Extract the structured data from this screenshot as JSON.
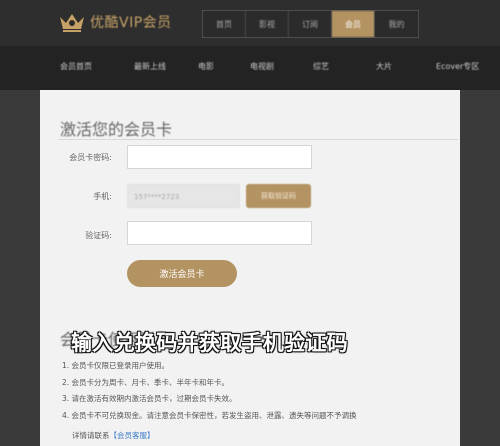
{
  "header": {
    "logo_text": "优酷VIP会员",
    "tabs": [
      {
        "label": "首页"
      },
      {
        "label": "影视"
      },
      {
        "label": "订阅"
      },
      {
        "label": "会员"
      },
      {
        "label": "我的"
      }
    ],
    "active_tab": 3
  },
  "nav": {
    "items": [
      {
        "label": "会员首页"
      },
      {
        "label": "最新上线"
      },
      {
        "label": "电影"
      },
      {
        "label": "电视剧"
      },
      {
        "label": "综艺"
      },
      {
        "label": "大片"
      },
      {
        "label": "Ecover专区"
      }
    ]
  },
  "form": {
    "title": "激活您的会员卡",
    "card_label": "会员卡密码:",
    "card_value": "",
    "phone_label": "手机:",
    "phone_value": "157****2723",
    "sms_button": "获取验证码",
    "code_label": "验证码:",
    "code_value": "",
    "submit_button": "激活会员卡"
  },
  "notice": {
    "title": "会员卡使用说明",
    "rules": [
      "1. 会员卡仅限已登录用户使用。",
      "2. 会员卡分为周卡、月卡、季卡、半年卡和年卡。",
      "3. 请在激活有效期内激活会员卡，过期会员卡失效。",
      "4. 会员卡不可兑换现金。请注意会员卡保密性，若发生盗用、泄露、遗失等问题不予调换"
    ],
    "contact_prefix": "详情请联系",
    "contact_link": "【会员客服】"
  },
  "overlay": {
    "caption": "输入兑换码并获取手机验证码"
  },
  "colors": {
    "accent": "#b49362",
    "header_bg": "#2e2e2e",
    "nav_bg": "#232323",
    "panel_bg": "#f2f2f2"
  }
}
